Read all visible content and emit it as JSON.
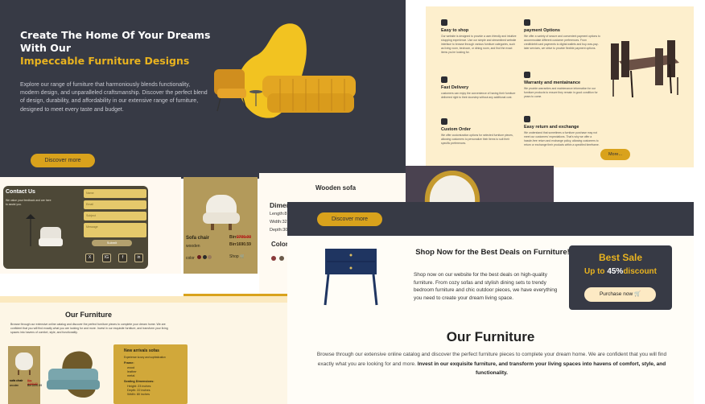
{
  "hero": {
    "title_line1": "Create The Home Of Your Dreams",
    "title_line2": "With Our",
    "title_accent": "Impeccable Furniture Designs",
    "description": "Explore our range of furniture that harmoniously blends functionality, modern design, and unparalleled craftsmanship. Discover the perfect blend of design, durability, and affordability in our extensive range of furniture, designed to meet every taste and budget.",
    "button": "Discover more"
  },
  "features": {
    "items": [
      {
        "title": "Easy to shop",
        "icon": "cart-icon",
        "desc": "Our website is designed to provide a user-friendly and intuitive shopping experience. Use our simple and streamlined website interface to browse through various furniture categories, such as living room, bedroom, or dining room, and find the exact items you're looking for."
      },
      {
        "title": "payment Options",
        "icon": "card-icon",
        "desc": "We offer a variety of secure and convenient payment options to accommodate different customer preferences. From credit/debit card payments to digital wallets and buy-now-pay-later services, we strive to provide flexible payment options."
      },
      {
        "title": "Fast Delivery",
        "icon": "truck-icon",
        "desc": "customers can enjoy the convenience of having their furniture delivered right to their doorstep without any additional cost."
      },
      {
        "title": "Warranty and mentainance",
        "icon": "shield-icon",
        "desc": "We provide warranties and maintenance information for our furniture products to ensure they remain in good condition for years to come."
      },
      {
        "title": "Custom Order",
        "icon": "edit-icon",
        "desc": "We offer customization options for selected furniture pieces, allowing customers to personalize their items to suit their specific preferences."
      },
      {
        "title": "Easy return and exchange",
        "icon": "return-icon",
        "desc": "We understand that sometimes a furniture purchase may not meet our customers' expectations. That's why we offer a hassle-free return and exchange policy, allowing customers to return or exchange their products within a specified timeframe."
      }
    ],
    "more": "More..."
  },
  "contact": {
    "title": "Contact Us",
    "subtitle": "We value your feedback and are here to assist you.",
    "fields": [
      "Name",
      "Email",
      "Subject"
    ],
    "message": "Message",
    "submit": "Submit",
    "social": [
      "X",
      "IG",
      "f",
      "in"
    ]
  },
  "product": {
    "name": "Sofa chair",
    "category": "wooden",
    "old_price_label": "Birr",
    "old_price": "2700.00",
    "new_price": "Birr1690.59",
    "color_label": "color",
    "shop": "Shop 🛒"
  },
  "detail": {
    "title": "Wooden sofa",
    "dimensions_title": "Dimensions",
    "length": "Length:8",
    "width": "Width:32",
    "depth": "Depth:30",
    "color_label": "Colors"
  },
  "deal_page": {
    "button": "Discover more",
    "headline": "Shop Now for the Best Deals on Furniture!",
    "body": "Shop now on our website for the best deals on high-quality furniture. From cozy sofas and stylish dining sets to trendy bedroom furniture and chic outdoor pieces, we have everything you need to create your dream living space.",
    "sale_title": "Best Sale",
    "sale_prefix": "Up to ",
    "sale_pct": "45%",
    "sale_suffix": "discount",
    "purchase": "Purchase now 🛒",
    "section_title": "Our Furniture",
    "para_normal": "Browse through our extensive online catalog and discover the perfect furniture pieces to complete your dream home. We are confident that you will find exactly what you are looking for and more.",
    "para_bold": "Invest in our exquisite furniture, and transform your living spaces into havens of comfort, style, and functionality."
  },
  "our_left": {
    "title": "Our Furniture",
    "para": "Browse through our extensive online catalog and discover the perfect furniture pieces to complete your dream home. We are confident that you will find exactly what you are looking for and more. Invest in our exquisite furniture, and transform your living spaces into havens of comfort, style, and functionality.",
    "arrivals_title": "New arrivals sofas",
    "arrivals_sub": "Experience luxury and sophistication",
    "frame_label": "Frame:",
    "frame_items": [
      "wood",
      "leather",
      "metal"
    ],
    "seating_label": "Seating Dimensions:",
    "seating_items": [
      "Height: 23 inches",
      "Depth: 22 inches",
      "Width: 80 inches"
    ],
    "card_name": "sofa chair",
    "card_type": "wooden",
    "card_old": "Birr 2700.00",
    "card_new": "Birr1690.59"
  },
  "colors": {
    "accent": "#e9b31f",
    "dark": "#373a45",
    "cream": "#fdefcd"
  }
}
